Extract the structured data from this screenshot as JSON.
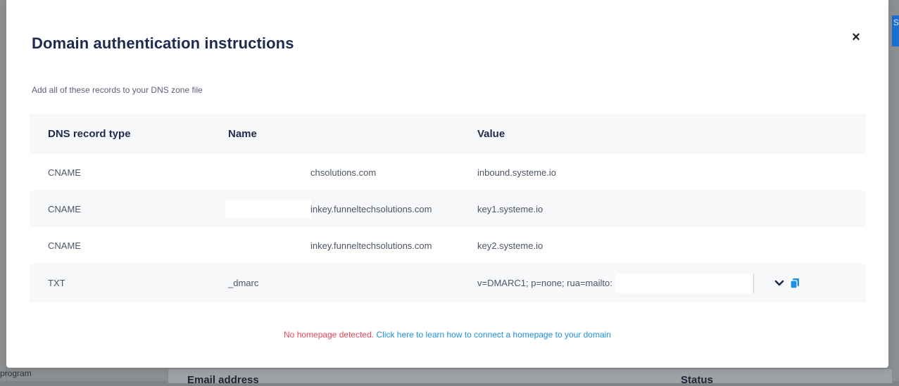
{
  "background": {
    "top_button_label": "S",
    "sidebar_text": "program",
    "table_columns": [
      "Email address",
      "Status"
    ]
  },
  "modal": {
    "title": "Domain authentication instructions",
    "close_label": "×",
    "subtitle": "Add all of these records to your DNS zone file",
    "table": {
      "headers": {
        "type": "DNS record type",
        "name": "Name",
        "value": "Value"
      },
      "rows": [
        {
          "type": "CNAME",
          "name": "chsolutions.com",
          "value": "inbound.systeme.io"
        },
        {
          "type": "CNAME",
          "name": "inkey.funneltechsolutions.com",
          "value": "key1.systeme.io"
        },
        {
          "type": "CNAME",
          "name": "inkey.funneltechsolutions.com",
          "value": "key2.systeme.io"
        },
        {
          "type": "TXT",
          "name": "_dmarc",
          "value": "v=DMARC1; p=none; rua=mailto:"
        }
      ]
    },
    "footer": {
      "warning": "No homepage detected.",
      "link": "Click here to learn how to connect a homepage to your domain"
    }
  },
  "icons": {
    "close": "close-icon",
    "expand": "chevron-down-icon",
    "copy": "copy-icon"
  },
  "colors": {
    "title": "#1f2a4f",
    "warning": "#e8455a",
    "link": "#1d8fe0",
    "accent": "#1b6fd0"
  }
}
